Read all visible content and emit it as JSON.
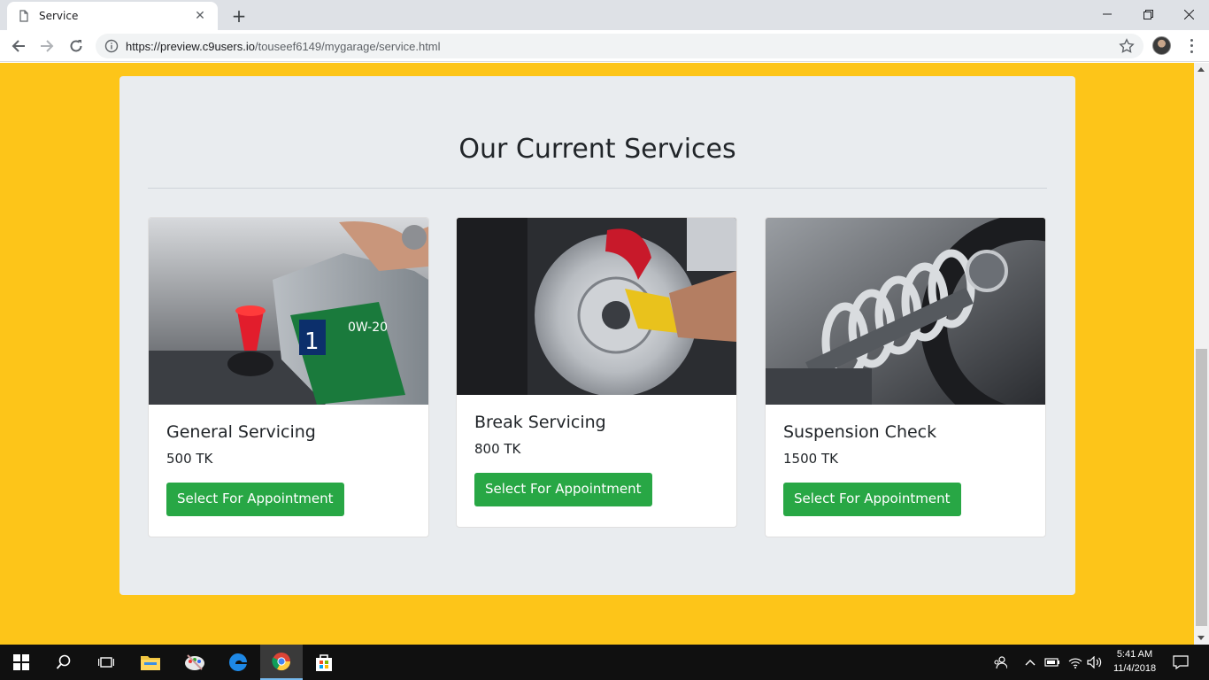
{
  "browser": {
    "tab_title": "Service",
    "url_host": "https://preview.c9users.io",
    "url_path": "/touseef6149/mygarage/service.html"
  },
  "page": {
    "heading": "Our Current Services",
    "services": [
      {
        "name": "General Servicing",
        "price": "500 TK",
        "button": "Select For Appointment",
        "image": "oil-change-photo"
      },
      {
        "name": "Break Servicing",
        "price": "800 TK",
        "button": "Select For Appointment",
        "image": "brake-disc-photo"
      },
      {
        "name": "Suspension Check",
        "price": "1500 TK",
        "button": "Select For Appointment",
        "image": "suspension-coil-photo"
      }
    ]
  },
  "taskbar": {
    "time": "5:41 AM",
    "date": "11/4/2018"
  },
  "colors": {
    "page_bg": "#fdc519",
    "jumbotron_bg": "#e9ecef",
    "button_green": "#28a745"
  }
}
